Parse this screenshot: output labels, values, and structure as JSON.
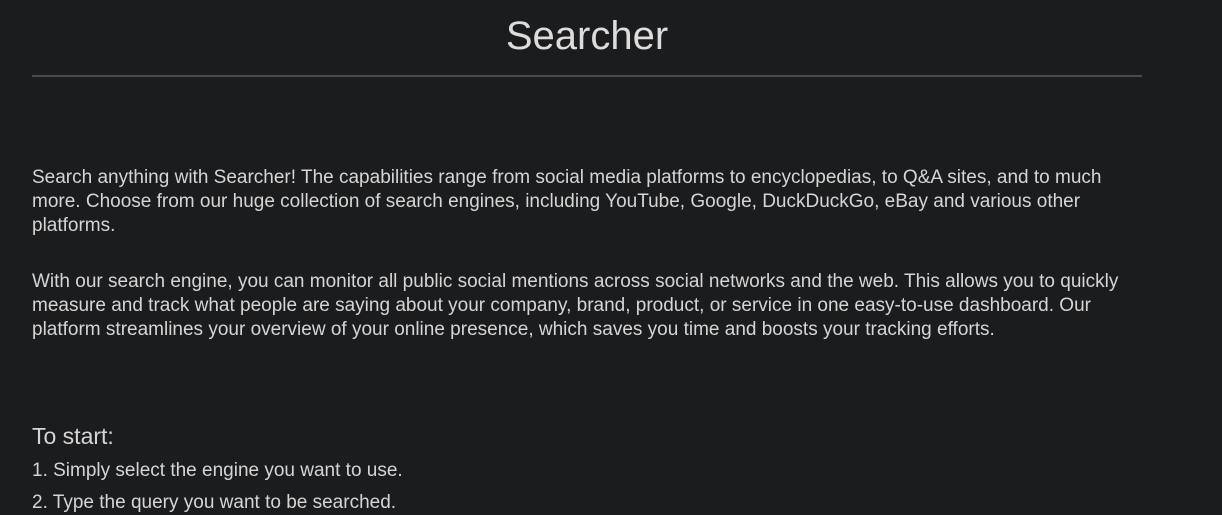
{
  "header": {
    "title": "Searcher"
  },
  "intro": {
    "paragraphs": [
      "Search anything with Searcher! The capabilities range from social media platforms to encyclopedias, to Q&A sites, and to much more. Choose from our huge collection of search engines, including YouTube, Google, DuckDuckGo, eBay and various other platforms.",
      "With our search engine, you can monitor all public social mentions across social networks and the web. This allows you to quickly measure and track what people are saying about your company, brand, product, or service in one easy-to-use dashboard. Our platform streamlines your overview of your online presence, which saves you time and boosts your tracking efforts."
    ]
  },
  "start": {
    "heading": "To start:",
    "steps": [
      "1. Simply select the engine you want to use.",
      "2. Type the query you want to be searched."
    ]
  },
  "colors": {
    "background": "#1b1c1e",
    "text": "#d5d5d5",
    "divider": "#4a4b4e"
  }
}
